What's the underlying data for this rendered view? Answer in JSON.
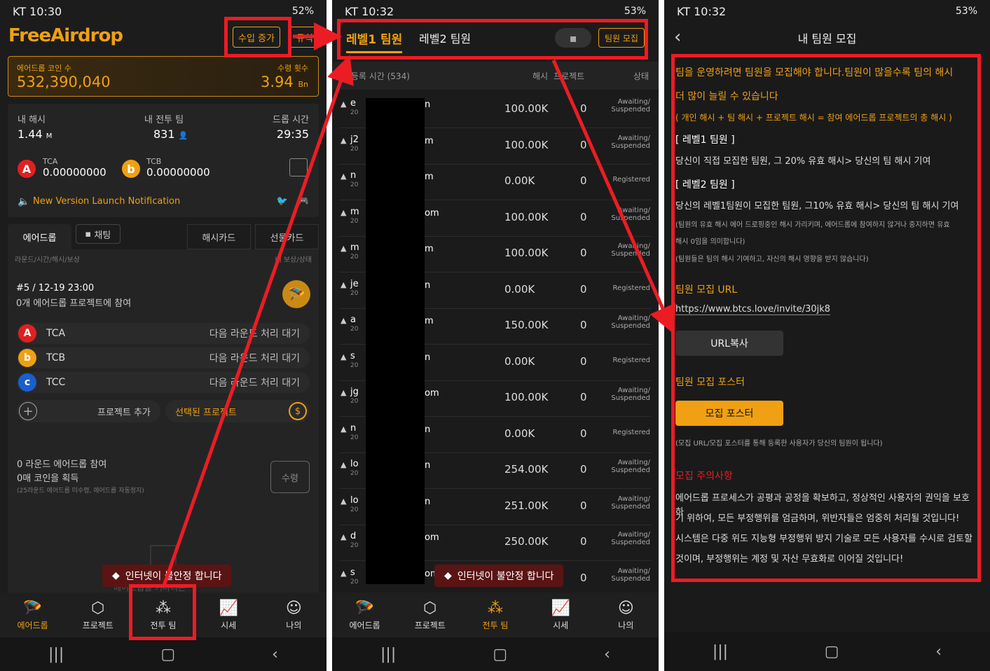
{
  "p1": {
    "status": {
      "left": "KT 10:30",
      "right": "52%"
    },
    "logo": "FreeAirdrop",
    "btn_income": "수입 증가",
    "btn_rule": "규칙",
    "coin_label": "에어드롭 코인 수",
    "coin_value": "532,390,040",
    "receive_label": "수령 횟수",
    "receive_value": "3.94",
    "receive_unit": "Bn",
    "my_hash_label": "내 해시",
    "my_hash_value": "1.44",
    "my_hash_unit": "M",
    "team_label": "내 전투 팀",
    "team_value": "831",
    "drop_label": "드롭 시간",
    "drop_value": "29:35",
    "tca_label": "TCA",
    "tca_value": "0.00000000",
    "tcb_label": "TCB",
    "tcb_value": "0.00000000",
    "notice": "New Version Launch Notification",
    "tabs": [
      "에어드롭",
      "채팅",
      "해시카드",
      "선물카드"
    ],
    "table_hdr_left": "라운드/시간/해시/보상",
    "table_hdr_right": "내 보상/상태",
    "round": "#5 / 12-19 23:00",
    "round_sub": "0개 에어드롭 프로젝트에 참여",
    "coins": [
      {
        "name": "TCA",
        "status": "다음 라운드 처리 대기"
      },
      {
        "name": "TCB",
        "status": "다음 라운드 처리 대기"
      },
      {
        "name": "TCC",
        "status": "다음 라운드 처리 대기"
      }
    ],
    "add_project": "프로젝트 추가",
    "selected_project": "선택된 프로젝트",
    "part_title": "0 라운드 에어드롭 참여",
    "part_coins": "0매 코인을 획득",
    "part_note": "(25라운드 에어드롭 미수령, 에어드롭 자동정지)",
    "btn_receive": "수령",
    "partial_text": "에어드롭을 기다리는",
    "toast": "인터넷이 불안정 합니다"
  },
  "nav": [
    "에어드롭",
    "프로젝트",
    "전투 팀",
    "시세",
    "나의"
  ],
  "p2": {
    "status": {
      "left": "KT 10:32",
      "right": "53%"
    },
    "tab1": "레벨1 팀원",
    "tab2": "레벨2 팀원",
    "btn_recruit": "팀원 모집",
    "hdr_id": "ID/등록 시간 (534)",
    "hdr_hash": "해시",
    "hdr_proj": "프로젝트",
    "hdr_status": "상태",
    "rows": [
      {
        "p": "e",
        "s": "n",
        "hash": "100.00K",
        "proj": "0",
        "st1": "Awaiting/",
        "st2": "Suspended"
      },
      {
        "p": "j2",
        "s": "m",
        "hash": "100.00K",
        "proj": "0",
        "st1": "Awaiting/",
        "st2": "Suspended"
      },
      {
        "p": "n",
        "s": "m",
        "hash": "0.00K",
        "proj": "0",
        "st1": "Registered",
        "st2": ""
      },
      {
        "p": "m",
        "s": "om",
        "hash": "100.00K",
        "proj": "0",
        "st1": "Awaiting/",
        "st2": "Suspended"
      },
      {
        "p": "m",
        "s": "m",
        "hash": "100.00K",
        "proj": "0",
        "st1": "Awaiting/",
        "st2": "Suspended"
      },
      {
        "p": "je",
        "s": "n",
        "hash": "0.00K",
        "proj": "0",
        "st1": "Registered",
        "st2": ""
      },
      {
        "p": "a",
        "s": "m",
        "hash": "150.00K",
        "proj": "0",
        "st1": "Awaiting/",
        "st2": "Suspended"
      },
      {
        "p": "s",
        "s": "n",
        "hash": "0.00K",
        "proj": "0",
        "st1": "Registered",
        "st2": ""
      },
      {
        "p": "jg",
        "s": "om",
        "hash": "100.00K",
        "proj": "0",
        "st1": "Awaiting/",
        "st2": "Suspended"
      },
      {
        "p": "n",
        "s": "n",
        "hash": "0.00K",
        "proj": "0",
        "st1": "Registered",
        "st2": ""
      },
      {
        "p": "lo",
        "s": "n",
        "hash": "254.00K",
        "proj": "0",
        "st1": "Awaiting/",
        "st2": "Suspended"
      },
      {
        "p": "lo",
        "s": "n",
        "hash": "251.00K",
        "proj": "0",
        "st1": "Awaiting/",
        "st2": "Suspended"
      },
      {
        "p": "d",
        "s": "om",
        "hash": "250.00K",
        "proj": "0",
        "st1": "Awaiting/",
        "st2": "Suspended"
      },
      {
        "p": "s",
        "s": "om",
        "hash": "",
        "proj": "0",
        "st1": "Awaiting/",
        "st2": "Suspended"
      }
    ],
    "row_sub": "20",
    "toast": "인터넷이 불안정 합니다"
  },
  "p3": {
    "status": {
      "left": "KT 10:32",
      "right": "53%"
    },
    "title": "내 팀원 모집",
    "intro1": "팀을 운영하려면 팀원을 모집해야 합니다.팀원이 많을수록 팀의 해시",
    "intro2": "더 많이 늘릴 수 있습니다",
    "formula": "( 개인 해시 + 팀 해시 + 프로젝트 해시 = 참여 에어드롭 프로젝트의 총 해시 )",
    "lv1_title": "[ 레벨1 팀원 ]",
    "lv1_desc": "당신이 직접 모집한 팀원, 그 20% 유효 해시> 당신의 팀 해시 기여",
    "lv2_title": "[ 레벨2 팀원 ]",
    "lv2_desc": "당신의 레벨1팀원이 모집한 팀원, 그10% 유효 해시> 당신의 팀 해시 기여",
    "note1a": "(팀원의 유효 해시 에어 드로핑중인 해시 가리키며, 에어드롭에 참여하지 않거나 중지하면 유효",
    "note1b": "해시 0임을 의미합니다)",
    "note2": "(팀원들은 팀의 해시 기여하고, 자신의 해시  영향을 받지 않습니다)",
    "url_title": "팀원 모집 URL",
    "url": "https://www.btcs.love/invite/30jk8",
    "btn_copy": "URL복사",
    "poster_title": "팀원 모집 포스터",
    "btn_poster": "모집 포스터",
    "poster_note": "(모집 URL/모집 포스터를 통해 등록한 사용자가 당신의 팀원이 됩니다)",
    "caution_title": "모집 주의사항",
    "caution1": "에어드롭 프로세스가 공평과 공정을 확보하고, 정상적인 사용자의 권익을 보호하",
    "caution2": "기 위하여, 모든 부정행위를 엄금하며, 위반자들은 엄중히 처리될 것입니다!",
    "caution3": "시스템은 다중 위도 지능형 부정행위 방지 기술로 모든 사용자를 수시로 검토할",
    "caution4": "것이며, 부정행위는 계정 및 자산 무효화로 이어질 것입니다!"
  },
  "colors": {
    "accent": "#f0a012",
    "annotation": "#ec1c24"
  }
}
